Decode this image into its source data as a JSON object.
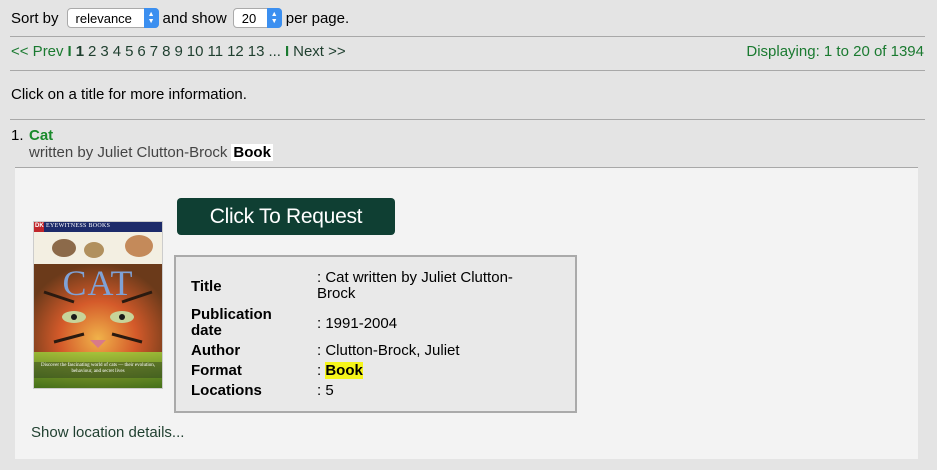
{
  "sort": {
    "label_sort_by": "Sort by",
    "sort_value": "relevance",
    "label_and_show": "and show",
    "per_page_value": "20",
    "label_per_page": "per page."
  },
  "pager": {
    "prev": "<< Prev",
    "sep1": "I",
    "current": "1",
    "pages": [
      "2",
      "3",
      "4",
      "5",
      "6",
      "7",
      "8",
      "9",
      "10",
      "11",
      "12",
      "13"
    ],
    "ellipsis": "...",
    "sep2": "I",
    "next": "Next >>",
    "displaying": "Displaying: 1 to 20 of 1394"
  },
  "instructions": "Click on a title for more information.",
  "result": {
    "number": "1.",
    "title": "Cat",
    "byline": "written by Juliet Clutton-Brock",
    "format_badge": "Book",
    "request_button": "Click To Request",
    "cover": {
      "series": "EYEWITNESS BOOKS",
      "publisher_mark": "DK",
      "title": "CAT",
      "blurb": "Discover the fascinating world of cats — their evolution, behaviour, and secret lives"
    },
    "details": {
      "title_label": "Title",
      "title_value": ": Cat written by Juliet Clutton-Brock",
      "pubdate_label": "Publication date",
      "pubdate_value": ": 1991-2004",
      "author_label": "Author",
      "author_value": ": Clutton-Brock, Juliet",
      "format_label": "Format",
      "format_colon": ": ",
      "format_value": "Book",
      "locations_label": "Locations",
      "locations_value": ": 5"
    },
    "show_location_details": "Show location details..."
  },
  "colors": {
    "link_green": "#1a7a30",
    "button_dark_green": "#0f3f33",
    "highlight_yellow": "#f5f51a"
  }
}
